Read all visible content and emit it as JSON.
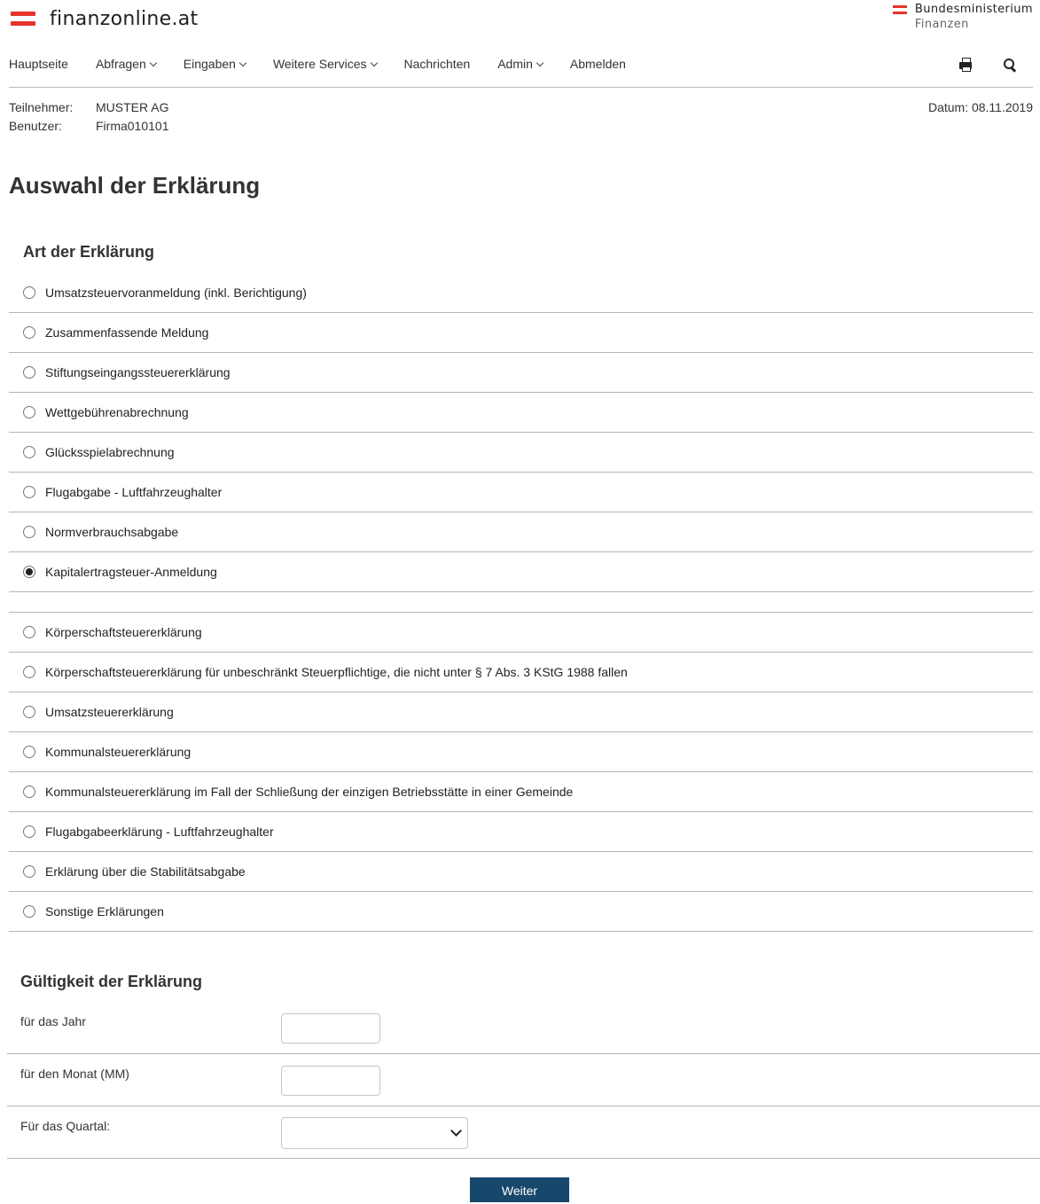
{
  "brand": {
    "name": "finanzonline.at",
    "ministry_line1": "Bundesministerium",
    "ministry_line2": "Finanzen",
    "flag_color": "#e6332a"
  },
  "nav": {
    "items": [
      {
        "label": "Hauptseite",
        "dropdown": false
      },
      {
        "label": "Abfragen",
        "dropdown": true
      },
      {
        "label": "Eingaben",
        "dropdown": true
      },
      {
        "label": "Weitere Services",
        "dropdown": true
      },
      {
        "label": "Nachrichten",
        "dropdown": false
      },
      {
        "label": "Admin",
        "dropdown": true
      },
      {
        "label": "Abmelden",
        "dropdown": false
      }
    ],
    "tools": [
      "print-icon",
      "search-icon"
    ]
  },
  "participant": {
    "participant_label": "Teilnehmer:",
    "participant_value": "MUSTER AG",
    "user_label": "Benutzer:",
    "user_value": "Firma010101",
    "date_text": "Datum: 08.11.2019"
  },
  "page_title": "Auswahl der Erklärung",
  "declaration_type": {
    "title": "Art der Erklärung",
    "group_a": [
      {
        "label": "Umsatzsteuervoranmeldung (inkl. Berichtigung)",
        "checked": false
      },
      {
        "label": "Zusammenfassende Meldung",
        "checked": false
      },
      {
        "label": "Stiftungseingangssteuererklärung",
        "checked": false
      },
      {
        "label": "Wettgebührenabrechnung",
        "checked": false
      },
      {
        "label": "Glücksspielabrechnung",
        "checked": false
      },
      {
        "label": "Flugabgabe - Luftfahrzeughalter",
        "checked": false
      },
      {
        "label": "Normverbrauchsabgabe",
        "checked": false
      },
      {
        "label": "Kapitalertragsteuer-Anmeldung",
        "checked": true
      }
    ],
    "group_b": [
      {
        "label": "Körperschaftsteuererklärung",
        "checked": false
      },
      {
        "label": "Körperschaftsteuererklärung für unbeschränkt Steuerpflichtige, die nicht unter § 7 Abs. 3 KStG 1988 fallen",
        "checked": false
      },
      {
        "label": "Umsatzsteuererklärung",
        "checked": false
      },
      {
        "label": "Kommunalsteuererklärung",
        "checked": false
      },
      {
        "label": "Kommunalsteuererklärung im Fall der Schließung der einzigen Betriebsstätte in einer Gemeinde",
        "checked": false
      },
      {
        "label": "Flugabgabeerklärung - Luftfahrzeughalter",
        "checked": false
      },
      {
        "label": "Erklärung über die Stabilitätsabgabe",
        "checked": false
      },
      {
        "label": "Sonstige Erklärungen",
        "checked": false
      }
    ]
  },
  "validity": {
    "title": "Gültigkeit der Erklärung",
    "year_label": "für das Jahr",
    "year_value": "",
    "month_label": "für den Monat (MM)",
    "month_value": "",
    "quarter_label": "Für das Quartal:",
    "quarter_value": ""
  },
  "submit_label": "Weiter",
  "colors": {
    "accent_red": "#e6332a",
    "button_blue": "#17486b",
    "divider": "#b5b5b5"
  }
}
